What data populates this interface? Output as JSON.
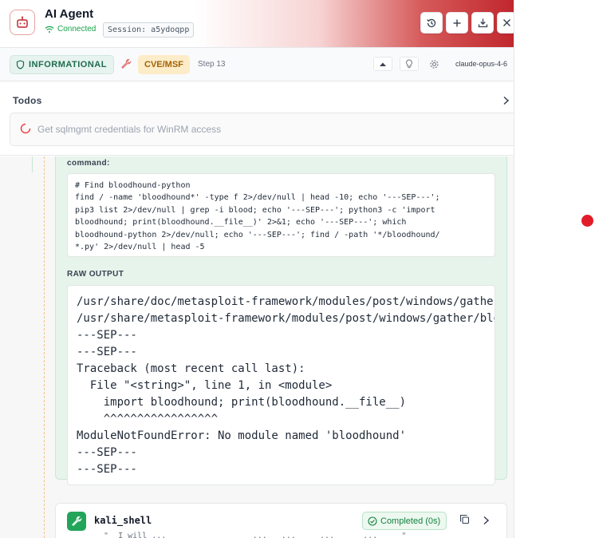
{
  "header": {
    "title": "AI Agent",
    "status": "Connected",
    "session": "Session: a5ydoqpp"
  },
  "status_bar": {
    "risk_badge": "INFORMATIONAL",
    "phase_badge": "CVE/MSF",
    "step": "Step 13",
    "model": "claude-opus-4-6"
  },
  "todos": {
    "title": "Todos",
    "items": [
      {
        "text": "Get sqlmgmt credentials for WinRM access",
        "state": "in-progress"
      }
    ]
  },
  "tool_result": {
    "command_label": "command:",
    "command_lines": [
      "# Find bloodhound-python",
      "find / -name 'bloodhound*' -type f 2>/dev/null | head -10; echo '---SEP---';",
      "pip3 list 2>/dev/null | grep -i blood; echo '---SEP---'; python3 -c 'import",
      "bloodhound; print(bloodhound.__file__)' 2>&1; echo '---SEP---'; which",
      "bloodhound-python 2>/dev/null; echo '---SEP---'; find / -path '*/bloodhound/",
      "*.py' 2>/dev/null | head -5"
    ],
    "output_label": "RAW OUTPUT",
    "output_lines": [
      "/usr/share/doc/metasploit-framework/modules/post/windows/gather",
      "/usr/share/metasploit-framework/modules/post/windows/gather/blo",
      "---SEP---",
      "---SEP---",
      "Traceback (most recent call last):",
      "  File \"<string>\", line 1, in <module>",
      "    import bloodhound; print(bloodhound.__file__)",
      "    ^^^^^^^^^^^^^^^^^",
      "ModuleNotFoundError: No module named 'bloodhound'",
      "---SEP---",
      "---SEP---"
    ]
  },
  "next_tool": {
    "name": "kali_shell",
    "status": "Completed (0s)",
    "preview": "  \"  I will ...                  ...   ...     ...      ...     \""
  },
  "colors": {
    "accent_red": "#c0272d",
    "success_green": "#22a55a",
    "cve_amber": "#a16207",
    "recording_dot": "#e11d2a"
  },
  "icons": [
    "robot-icon",
    "wifi-icon",
    "history-icon",
    "plus-icon",
    "download-icon",
    "close-icon",
    "shield-icon",
    "wrench-icon",
    "chevron-up-icon",
    "lightbulb-icon",
    "gear-icon",
    "chevron-right-icon",
    "spinner-icon",
    "check-circle-icon",
    "copy-icon"
  ]
}
